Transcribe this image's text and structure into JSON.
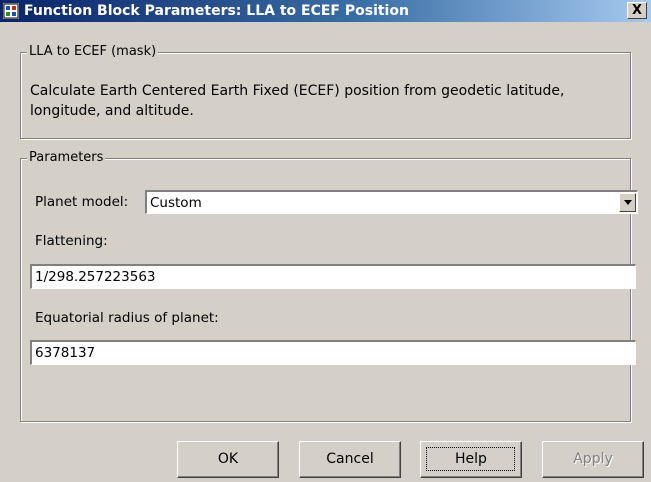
{
  "window": {
    "title": "Function Block Parameters: LLA to ECEF Position",
    "close_label": "X"
  },
  "mask": {
    "group_label": "LLA to ECEF (mask)",
    "description": "Calculate Earth Centered Earth Fixed (ECEF) position from geodetic latitude, longitude, and altitude."
  },
  "parameters": {
    "group_label": "Parameters",
    "planet_model_label": "Planet model:",
    "planet_model_value": "Custom",
    "flattening_label": "Flattening:",
    "flattening_value": "1/298.257223563",
    "radius_label": "Equatorial radius of planet:",
    "radius_value": "6378137"
  },
  "buttons": {
    "ok": "OK",
    "cancel": "Cancel",
    "help": "Help",
    "apply": "Apply"
  }
}
